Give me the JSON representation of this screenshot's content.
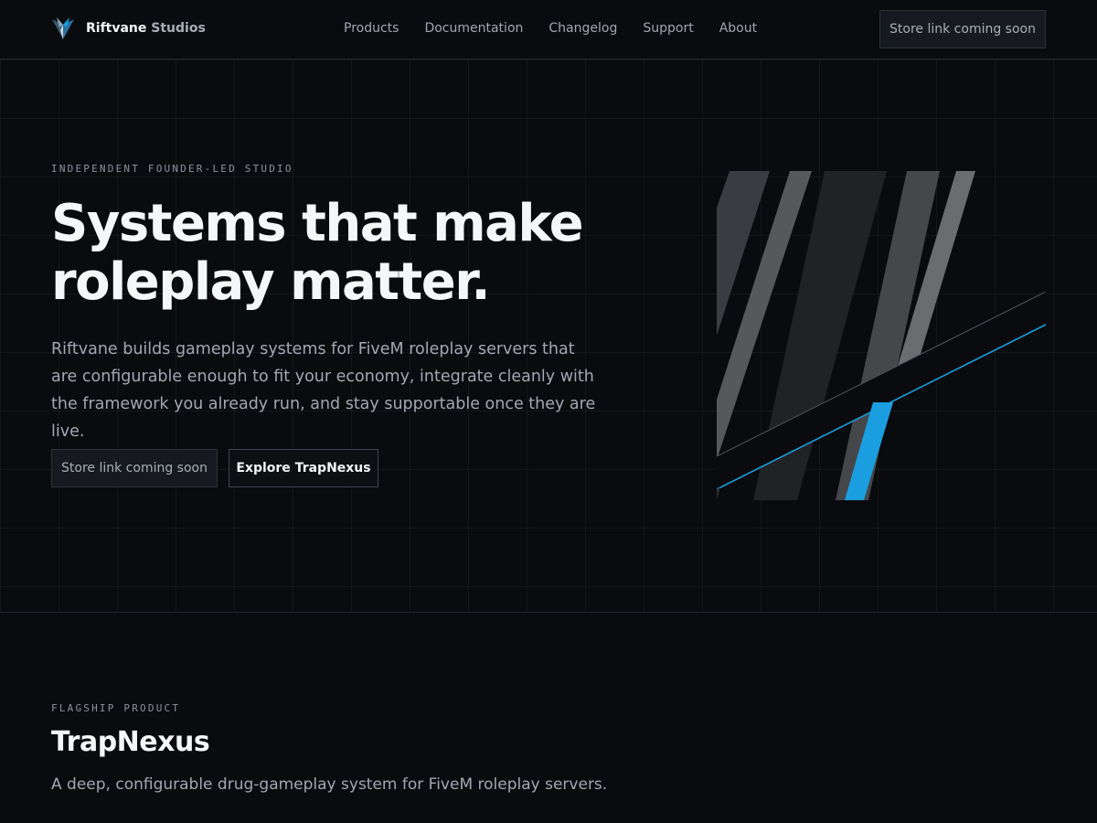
{
  "brand": {
    "name_primary": "Riftvane",
    "name_secondary": "Studios",
    "logo_icon": "riftvane-logo-icon"
  },
  "nav": {
    "links": [
      {
        "label": "Products"
      },
      {
        "label": "Documentation"
      },
      {
        "label": "Changelog"
      },
      {
        "label": "Support"
      },
      {
        "label": "About"
      }
    ],
    "cta_label": "Store link coming soon"
  },
  "hero": {
    "eyebrow": "INDEPENDENT FOUNDER-LED STUDIO",
    "title_line1": "Systems that make",
    "title_line2": "roleplay matter.",
    "description": "Riftvane builds gameplay systems for FiveM roleplay servers that are configurable enough to fit your economy, integrate cleanly with the framework you already run, and stay supportable once they are live.",
    "primary_button": "Store link coming soon",
    "secondary_button": "Explore TrapNexus",
    "art_icon": "diagonal-stripes-graphic"
  },
  "product": {
    "eyebrow": "FLAGSHIP PRODUCT",
    "title": "TrapNexus",
    "description": "A deep, configurable drug-gameplay system for FiveM roleplay servers."
  },
  "colors": {
    "background": "#0a0b0e",
    "accent": "#1a9ee0",
    "text_primary": "#f5f6f8",
    "text_muted": "#a2a8b2"
  }
}
